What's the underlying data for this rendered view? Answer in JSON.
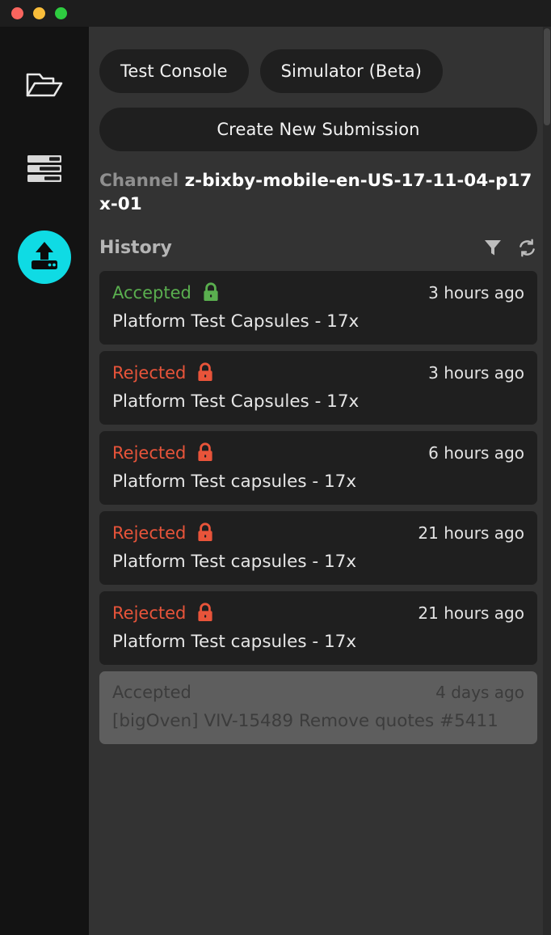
{
  "window": {
    "controls": [
      {
        "name": "close",
        "color": "#f9655e"
      },
      {
        "name": "minimize",
        "color": "#f9bd3a"
      },
      {
        "name": "zoom",
        "color": "#2ecc40"
      }
    ]
  },
  "sidebar": {
    "items": [
      {
        "icon": "open-folder-icon",
        "name": "files"
      },
      {
        "icon": "logs-icon",
        "name": "logs"
      },
      {
        "icon": "deploy-upload-icon",
        "name": "submissions",
        "active": true,
        "accent": "#0fdbe4"
      }
    ]
  },
  "toolbar": {
    "test_console_label": "Test Console",
    "simulator_label": "Simulator (Beta)",
    "create_submission_label": "Create New Submission"
  },
  "channel": {
    "label": "Channel",
    "value": "z-bixby-mobile-en-US-17-11-04-p17x-01"
  },
  "history": {
    "title": "History",
    "filter_icon": "filter-funnel-icon",
    "refresh_icon": "refresh-icon",
    "items": [
      {
        "status": "Accepted",
        "status_type": "accepted",
        "locked": true,
        "lock_color": "#5aaf4f",
        "time": "3 hours ago",
        "title": "Platform Test Capsules - 17x",
        "selected": false
      },
      {
        "status": "Rejected",
        "status_type": "rejected",
        "locked": true,
        "lock_color": "#e8543a",
        "time": "3 hours ago",
        "title": "Platform Test Capsules - 17x",
        "selected": false
      },
      {
        "status": "Rejected",
        "status_type": "rejected",
        "locked": true,
        "lock_color": "#e8543a",
        "time": "6 hours ago",
        "title": "Platform Test capsules - 17x",
        "selected": false
      },
      {
        "status": "Rejected",
        "status_type": "rejected",
        "locked": true,
        "lock_color": "#e8543a",
        "time": "21 hours ago",
        "title": "Platform Test capsules - 17x",
        "selected": false
      },
      {
        "status": "Rejected",
        "status_type": "rejected",
        "locked": true,
        "lock_color": "#e8543a",
        "time": "21 hours ago",
        "title": "Platform Test capsules - 17x",
        "selected": false
      },
      {
        "status": "Accepted",
        "status_type": "accepted",
        "locked": false,
        "lock_color": "",
        "time": "4 days ago",
        "title": "[bigOven] VIV-15489 Remove quotes #5411",
        "selected": true
      }
    ]
  },
  "colors": {
    "panel_bg": "#333333",
    "rail_bg": "#131313",
    "card_bg": "#1f1f1f",
    "card_selected_bg": "#5e5e5e",
    "accepted": "#5aaf4f",
    "rejected": "#e8543a",
    "accent": "#0fdbe4"
  }
}
